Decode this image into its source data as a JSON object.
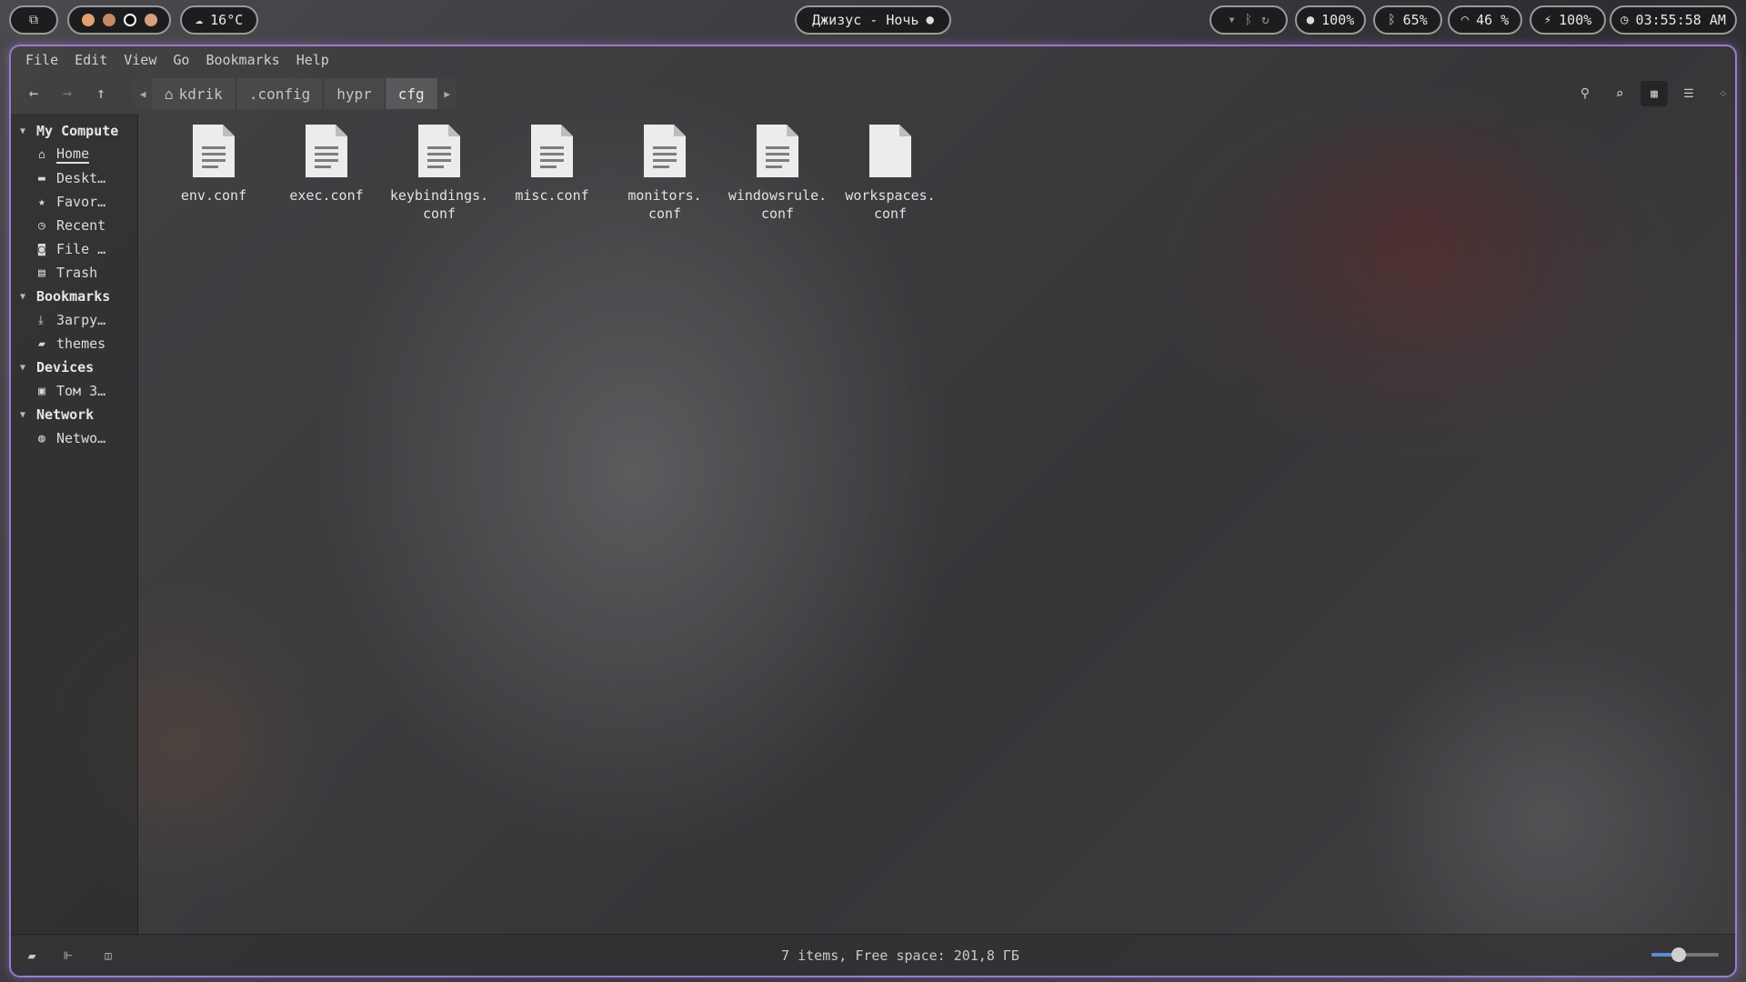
{
  "topbar": {
    "weather": {
      "icon": "cloud-icon",
      "temp": "16°C"
    },
    "media": {
      "title": "Джизус - Ночь"
    },
    "status": {
      "volume": "100%",
      "bluetooth": "65%",
      "wifi": "46 %",
      "battery": "100%",
      "clock": "03:55:58 AM"
    },
    "colors": {
      "dot1": "#e0a070",
      "dot2": "#c58a68",
      "dot3": "#111111",
      "dot4": "#d6a080"
    }
  },
  "window": {
    "accent": "#9b7bd1",
    "menu": [
      "File",
      "Edit",
      "View",
      "Go",
      "Bookmarks",
      "Help"
    ],
    "breadcrumbs": [
      "kdrik",
      ".config",
      "hypr",
      "cfg"
    ],
    "sidebar": {
      "my_computer": {
        "title": "My Compute",
        "items": [
          "Home",
          "Deskt…",
          "Favor…",
          "Recent",
          "File …",
          "Trash"
        ]
      },
      "bookmarks": {
        "title": "Bookmarks",
        "items": [
          "Загру…",
          "themes"
        ]
      },
      "devices": {
        "title": "Devices",
        "items": [
          "Том 3…"
        ]
      },
      "network": {
        "title": "Network",
        "items": [
          "Netwo…"
        ]
      }
    },
    "files": [
      {
        "name": "env.conf"
      },
      {
        "name": "exec.conf"
      },
      {
        "name": "keybindings.\nconf"
      },
      {
        "name": "misc.conf"
      },
      {
        "name": "monitors.\nconf"
      },
      {
        "name": "windowsrule.\nconf"
      },
      {
        "name": "workspaces.\nconf"
      }
    ],
    "status_text": "7 items, Free space: 201,8 ГБ",
    "zoom_level": 0.4
  }
}
